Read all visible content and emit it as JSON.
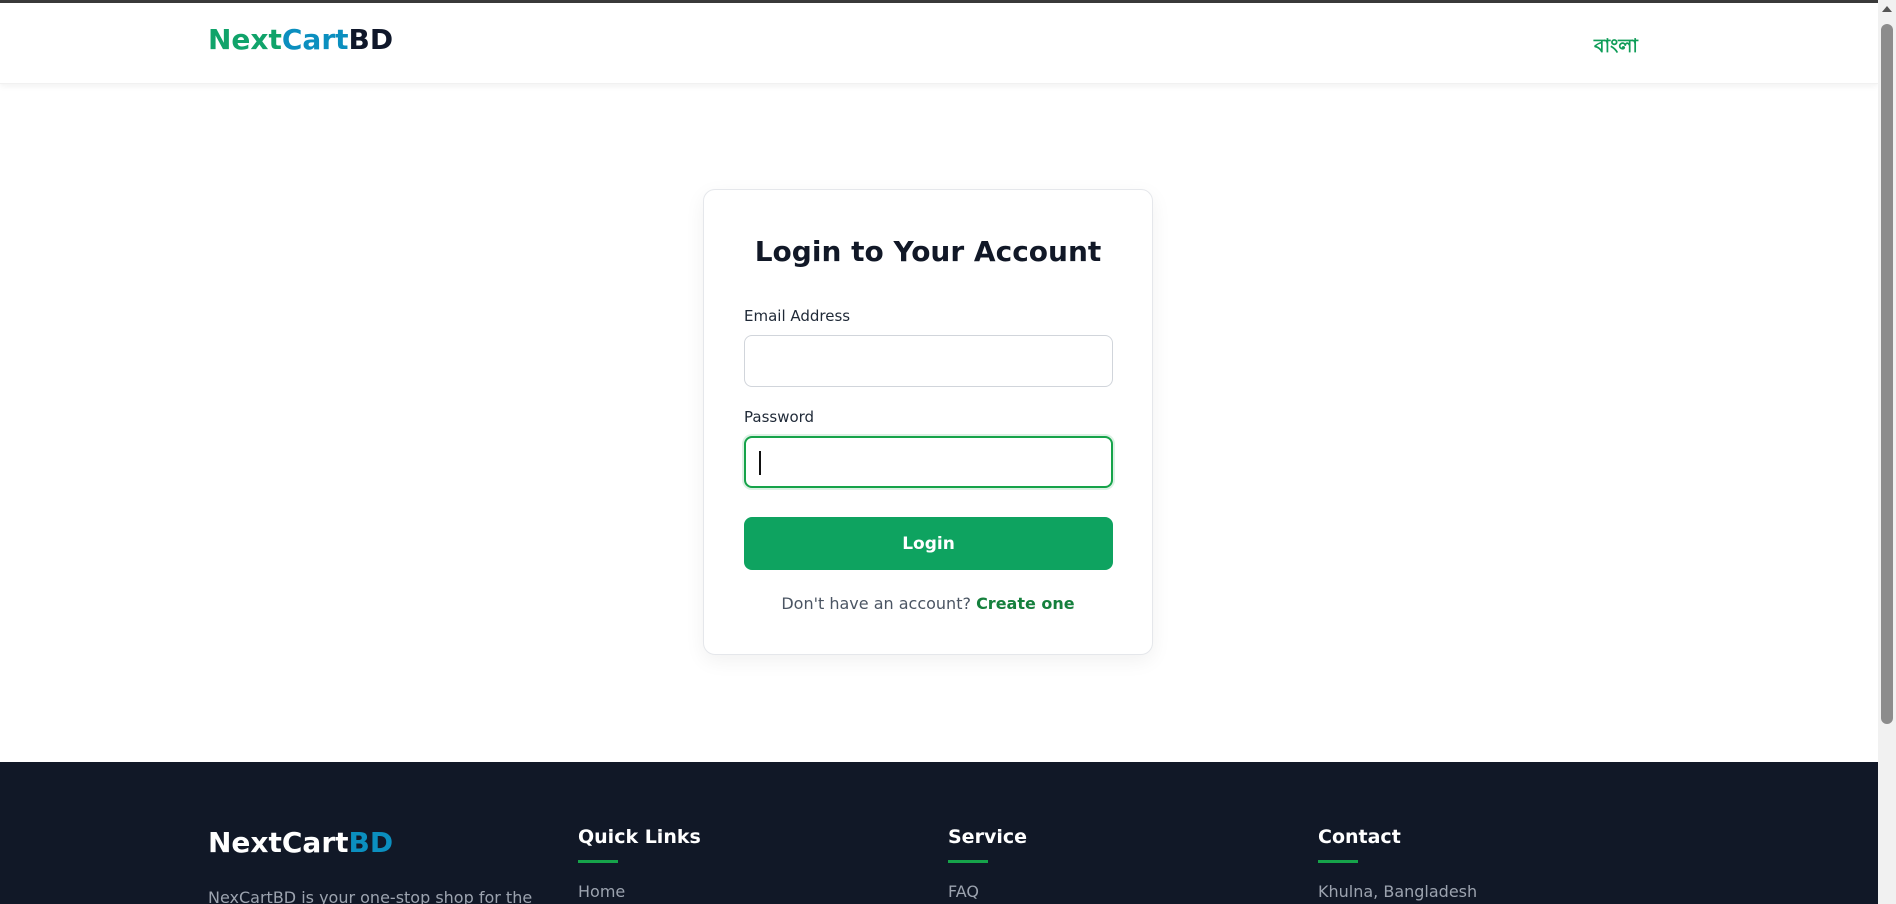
{
  "header": {
    "brand_part1": "Next",
    "brand_part2": "Cart",
    "brand_part3": "BD",
    "language_toggle": "বাংলা"
  },
  "login": {
    "title": "Login to Your Account",
    "email_label": "Email Address",
    "email_value": "",
    "password_label": "Password",
    "password_value": "",
    "submit_label": "Login",
    "signup_prompt": "Don't have an account?",
    "signup_link": "Create one"
  },
  "footer": {
    "brand_white": "NextCart",
    "brand_blue": "BD",
    "description": "NexCartBD is your one-stop shop for the",
    "quick_links_title": "Quick Links",
    "quick_links": [
      "Home"
    ],
    "service_title": "Service",
    "service_links": [
      "FAQ"
    ],
    "contact_title": "Contact",
    "contact_items": [
      "Khulna, Bangladesh"
    ]
  },
  "colors": {
    "primary_green": "#0ea360",
    "brand_blue": "#0b8fbf",
    "footer_bg": "#111827"
  }
}
